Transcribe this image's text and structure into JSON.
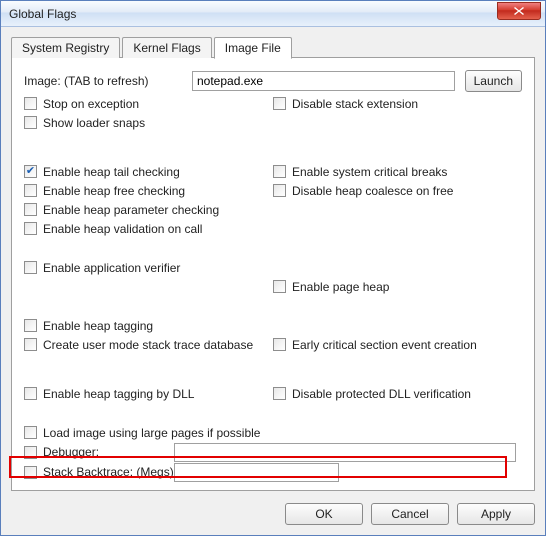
{
  "window": {
    "title": "Global Flags"
  },
  "tabs": {
    "t0": "System Registry",
    "t1": "Kernel Flags",
    "t2": "Image File"
  },
  "image_row": {
    "label": "Image: (TAB to refresh)",
    "value": "notepad.exe",
    "launch": "Launch"
  },
  "col_left": {
    "stop_exc": "Stop on exception",
    "show_loader": "Show loader snaps",
    "heap_tail": "Enable heap tail checking",
    "heap_free": "Enable heap free checking",
    "heap_param": "Enable heap parameter checking",
    "heap_valid": "Enable heap validation on call",
    "app_verifier": "Enable application verifier",
    "heap_tagging": "Enable heap tagging",
    "stack_trace_db": "Create user mode stack trace database",
    "heap_tag_dll": "Enable heap tagging by DLL",
    "large_pages": "Load image using large pages if possible",
    "debugger": "Debugger:",
    "stack_backtrace": "Stack Backtrace: (Megs)"
  },
  "col_right": {
    "disable_stack_ext": "Disable stack extension",
    "sys_crit_breaks": "Enable system critical breaks",
    "disable_coalesce": "Disable heap coalesce on free",
    "page_heap": "Enable page heap",
    "early_crit": "Early critical section event creation",
    "disable_dll_ver": "Disable protected DLL verification"
  },
  "footer": {
    "ok": "OK",
    "cancel": "Cancel",
    "apply": "Apply"
  }
}
